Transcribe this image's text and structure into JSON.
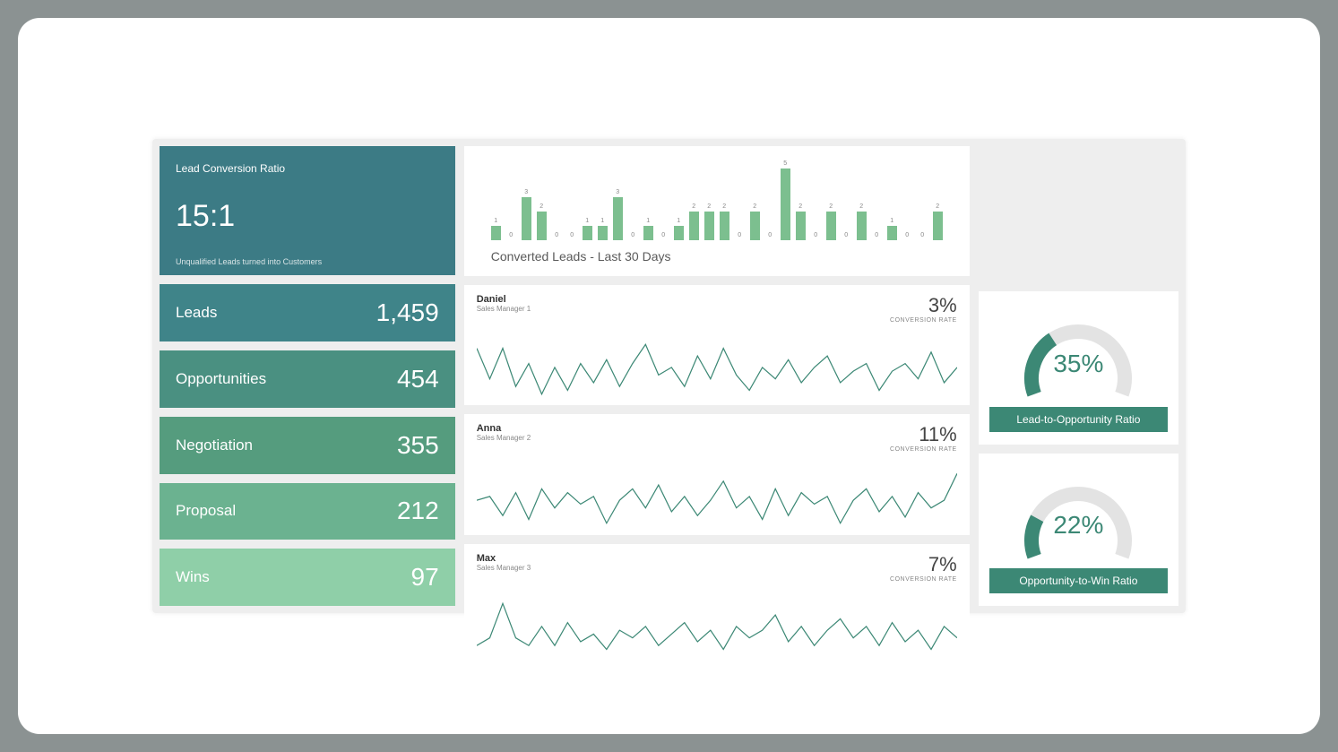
{
  "ratio": {
    "title": "Lead Conversion Ratio",
    "value": "15:1",
    "subtitle": "Unqualified Leads turned into Customers"
  },
  "funnel": [
    {
      "label": "Leads",
      "value": "1,459"
    },
    {
      "label": "Opportunities",
      "value": "454"
    },
    {
      "label": "Negotiation",
      "value": "355"
    },
    {
      "label": "Proposal",
      "value": "212"
    },
    {
      "label": "Wins",
      "value": "97"
    }
  ],
  "bars_title": "Converted Leads - Last 30 Days",
  "managers": [
    {
      "name": "Daniel",
      "role": "Sales Manager 1",
      "pct": "3%",
      "rate_label": "CONVERSION RATE"
    },
    {
      "name": "Anna",
      "role": "Sales Manager 2",
      "pct": "11%",
      "rate_label": "CONVERSION RATE"
    },
    {
      "name": "Max",
      "role": "Sales Manager 3",
      "pct": "7%",
      "rate_label": "CONVERSION RATE"
    }
  ],
  "gauges": [
    {
      "pct": "35%",
      "label": "Lead-to-Opportunity Ratio",
      "value": 35
    },
    {
      "pct": "22%",
      "label": "Opportunity-to-Win Ratio",
      "value": 22
    }
  ],
  "chart_data": {
    "bars": {
      "type": "bar",
      "title": "Converted Leads - Last 30 Days",
      "xlabel": "",
      "ylabel": "",
      "ylim": [
        0,
        5
      ],
      "values": [
        1,
        0,
        3,
        2,
        0,
        0,
        1,
        1,
        3,
        0,
        1,
        0,
        1,
        2,
        2,
        2,
        0,
        2,
        0,
        5,
        2,
        0,
        2,
        0,
        2,
        0,
        1,
        0,
        0,
        2
      ]
    },
    "sparklines": [
      {
        "type": "line",
        "name": "Daniel",
        "conversion_rate_pct": 3,
        "values": [
          30,
          70,
          30,
          80,
          50,
          90,
          55,
          85,
          50,
          75,
          45,
          80,
          50,
          25,
          65,
          55,
          80,
          40,
          70,
          30,
          65,
          85,
          55,
          70,
          45,
          75,
          55,
          40,
          75,
          60,
          50,
          85,
          60,
          50,
          70,
          35,
          75,
          55
        ]
      },
      {
        "type": "line",
        "name": "Anna",
        "conversion_rate_pct": 11,
        "values": [
          60,
          55,
          80,
          50,
          85,
          45,
          70,
          50,
          65,
          55,
          90,
          60,
          45,
          70,
          40,
          75,
          55,
          80,
          60,
          35,
          70,
          55,
          85,
          45,
          80,
          50,
          65,
          55,
          90,
          60,
          45,
          75,
          55,
          82,
          50,
          70,
          60,
          25
        ]
      },
      {
        "type": "line",
        "name": "Max",
        "conversion_rate_pct": 7,
        "values": [
          80,
          70,
          25,
          70,
          80,
          55,
          80,
          50,
          75,
          65,
          85,
          60,
          70,
          55,
          80,
          65,
          50,
          75,
          60,
          85,
          55,
          70,
          60,
          40,
          75,
          55,
          80,
          60,
          45,
          70,
          55,
          80,
          50,
          75,
          60,
          85,
          55,
          70
        ]
      }
    ],
    "gauges": [
      {
        "type": "gauge",
        "title": "Lead-to-Opportunity Ratio",
        "value_pct": 35
      },
      {
        "type": "gauge",
        "title": "Opportunity-to-Win Ratio",
        "value_pct": 22
      }
    ],
    "funnel": {
      "type": "table",
      "rows": [
        {
          "stage": "Leads",
          "count": 1459
        },
        {
          "stage": "Opportunities",
          "count": 454
        },
        {
          "stage": "Negotiation",
          "count": 355
        },
        {
          "stage": "Proposal",
          "count": 212
        },
        {
          "stage": "Wins",
          "count": 97
        }
      ]
    }
  }
}
